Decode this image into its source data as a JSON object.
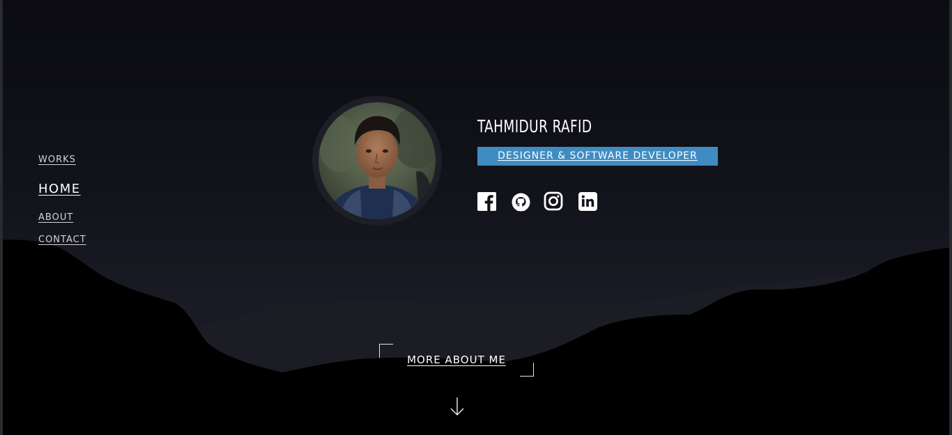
{
  "nav": {
    "works": "WORKS",
    "home": "HOME",
    "about": "ABOUT",
    "contact": "CONTACT"
  },
  "profile": {
    "name": "TAHMIDUR RAFID",
    "role": "DESIGNER & SOFTWARE DEVELOPER"
  },
  "social": [
    "facebook-icon",
    "github-icon",
    "instagram-icon",
    "linkedin-icon"
  ],
  "cta": {
    "more_about": "MORE ABOUT ME"
  },
  "colors": {
    "background": "#0b0c11",
    "accent": "#3f8cc3",
    "text": "#ffffff",
    "hills": "#000000"
  }
}
